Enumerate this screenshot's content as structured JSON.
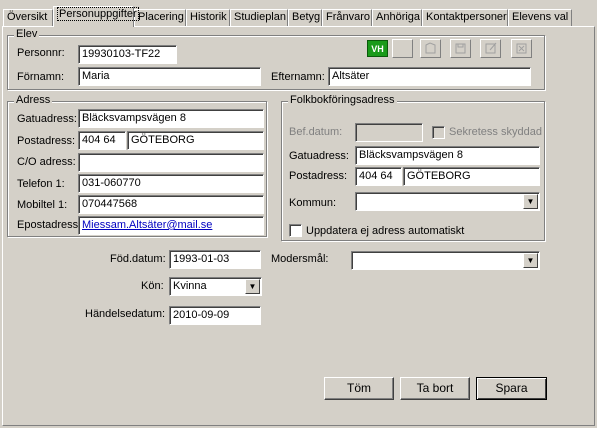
{
  "tabs": [
    "Översikt",
    "Personuppgifter",
    "Placering",
    "Historik",
    "Studieplan",
    "Betyg",
    "Frånvaro",
    "Anhöriga",
    "Kontaktpersoner",
    "Elevens val"
  ],
  "elev": {
    "title": "Elev",
    "personnr_label": "Personnr:",
    "personnr": "19930103-TF22",
    "fornamn_label": "Förnamn:",
    "fornamn": "Maria",
    "efternamn_label": "Efternamn:",
    "efternamn": "Altsäter",
    "badge": "VH"
  },
  "adress": {
    "title": "Adress",
    "gatuadress_label": "Gatuadress:",
    "gatuadress": "Bläcksvampsvägen 8",
    "postadress_label": "Postadress:",
    "postnr": "404 64",
    "ort": "GÖTEBORG",
    "co_label": "C/O adress:",
    "co": "",
    "telefon_label": "Telefon 1:",
    "telefon": "031-060770",
    "mobil_label": "Mobiltel 1:",
    "mobil": "070447568",
    "epost_label": "Epostadress:",
    "epost": "Miessam.Altsäter@mail.se"
  },
  "folkbok": {
    "title": "Folkbokföringsadress",
    "befdatum_label": "Bef.datum:",
    "befdatum": "",
    "sekretess_label": "Sekretess skyddad",
    "gatuadress_label": "Gatuadress:",
    "gatuadress": "Bläcksvampsvägen 8",
    "postadress_label": "Postadress:",
    "postnr": "404 64",
    "ort": "GÖTEBORG",
    "kommun_label": "Kommun:",
    "kommun": "",
    "uppdatera_label": "Uppdatera ej adress automatiskt"
  },
  "other": {
    "fod_label": "Föd.datum:",
    "fod": "1993-01-03",
    "kon_label": "Kön:",
    "kon": "Kvinna",
    "handelse_label": "Händelsedatum:",
    "handelse": "2010-09-09",
    "modersmal_label": "Modersmål:",
    "modersmal": ""
  },
  "buttons": {
    "tom": "Töm",
    "tabort": "Ta bort",
    "spara": "Spara"
  }
}
